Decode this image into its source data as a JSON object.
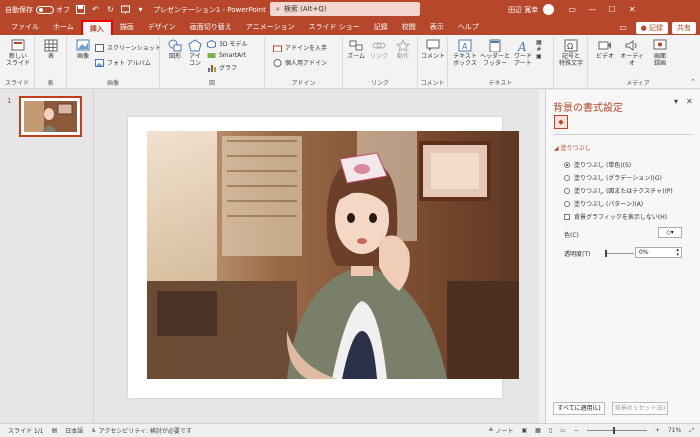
{
  "titlebar": {
    "autosave_label": "自動保存",
    "autosave_state": "オフ",
    "doc_title": "プレゼンテーション1 - PowerPoint",
    "search_placeholder": "検索 (Alt+Q)",
    "user_name": "田辺 寛幸"
  },
  "tabs": [
    "ファイル",
    "ホーム",
    "挿入",
    "描画",
    "デザイン",
    "画面切り替え",
    "アニメーション",
    "スライド ショー",
    "記録",
    "校閲",
    "表示",
    "ヘルプ"
  ],
  "tab_actions": {
    "record": "● 記録",
    "share": "共有"
  },
  "ribbon": {
    "new_slide": "新しい\nスライド",
    "table": "表",
    "images": "画像",
    "screenshot": "スクリーンショット",
    "photo_album": "フォト アルバム",
    "shapes": "図形",
    "icons": "アイ\nコン",
    "model3d": "3D モデル",
    "smartart": "SmartArt",
    "graph": "グラフ",
    "get_addins": "アドインを入手",
    "personal_addins": "個人用アドイン",
    "zoom": "ズーム",
    "link": "リンク",
    "action": "動作",
    "comment": "コメント",
    "textbox": "テキスト\nボックス",
    "header_footer": "ヘッダーと\nフッター",
    "wordart": "ワード\nアート",
    "symbols": "記号と\n特殊文字",
    "video": "ビデオ",
    "audio": "オーディオ",
    "screen_recording": "画面\n録画",
    "groups": {
      "slides": "スライド",
      "table": "表",
      "images": "画像",
      "illustrations": "図",
      "addins": "アドイン",
      "links": "リンク",
      "comments": "コメント",
      "text": "テキスト",
      "media": "メディア"
    }
  },
  "thumbs": {
    "slide_number": "1"
  },
  "format_pane": {
    "title": "背景の書式設定",
    "section": "塗りつぶし",
    "options": [
      "塗りつぶし (単色)(S)",
      "塗りつぶし (グラデーション)(G)",
      "塗りつぶし (図またはテクスチャ)(P)",
      "塗りつぶし (パターン)(A)"
    ],
    "hide_graphics": "背景グラフィックを表示しない(H)",
    "color_label": "色(C)",
    "transparency_label": "透明度(T)",
    "transparency_value": "0%",
    "apply_all": "すべてに適用(L)",
    "reset": "背景のリセット(B)"
  },
  "status": {
    "slide": "スライド 1/1",
    "language": "日本語",
    "accessibility": "アクセシビリティ: 検討が必要です",
    "notes": "ノート",
    "zoom": "71%"
  },
  "colors": {
    "accent": "#b7472a",
    "highlight_border": "#e00000"
  }
}
